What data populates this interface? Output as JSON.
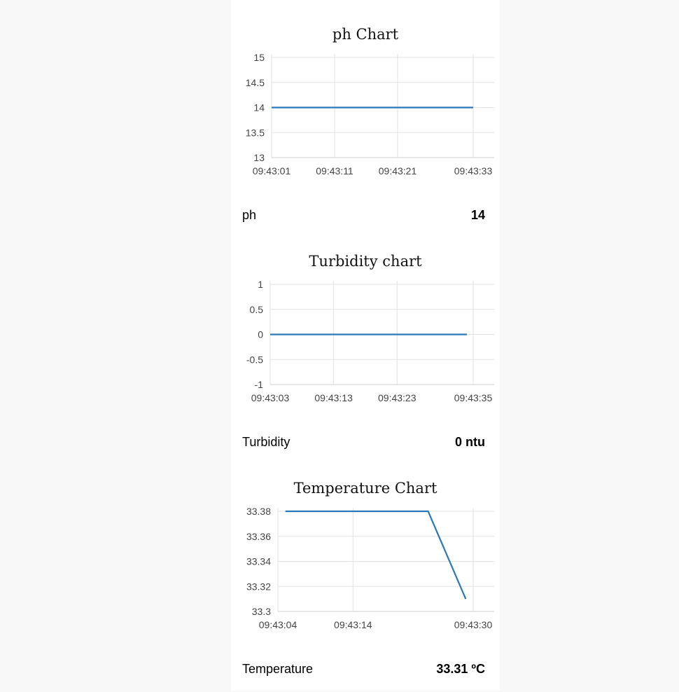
{
  "chart_data": [
    {
      "type": "line",
      "title": "ph Chart",
      "x": [
        "09:43:01",
        "09:43:33"
      ],
      "y": [
        14,
        14
      ],
      "x_ticks": [
        "09:43:01",
        "09:43:11",
        "09:43:21",
        "09:43:33"
      ],
      "y_ticks": [
        "15",
        "14.5",
        "14",
        "13.5",
        "13"
      ],
      "ylim": [
        13,
        15
      ],
      "grid": true,
      "color": "#2a78b8"
    },
    {
      "type": "line",
      "title": "Turbidity chart",
      "x": [
        "09:43:03",
        "09:43:34"
      ],
      "y": [
        0,
        0
      ],
      "x_ticks": [
        "09:43:03",
        "09:43:13",
        "09:43:23",
        "09:43:35"
      ],
      "y_ticks": [
        "1",
        "0.5",
        "0",
        "-0.5",
        "-1"
      ],
      "ylim": [
        -1,
        1
      ],
      "grid": true,
      "color": "#2a78b8"
    },
    {
      "type": "line",
      "title": "Temperature Chart",
      "x": [
        "09:43:05",
        "09:43:24",
        "09:43:29"
      ],
      "y": [
        33.38,
        33.38,
        33.31
      ],
      "x_ticks": [
        "09:43:04",
        "09:43:14",
        "09:43:30"
      ],
      "y_ticks": [
        "33.38",
        "33.36",
        "33.34",
        "33.32",
        "33.3"
      ],
      "ylim": [
        33.3,
        33.38
      ],
      "grid": true,
      "color": "#2a78b8"
    }
  ],
  "readings": [
    {
      "label": "ph",
      "value": "14"
    },
    {
      "label": "Turbidity",
      "value": "0 ntu"
    },
    {
      "label": "Temperature",
      "value": "33.31 ºC"
    }
  ]
}
